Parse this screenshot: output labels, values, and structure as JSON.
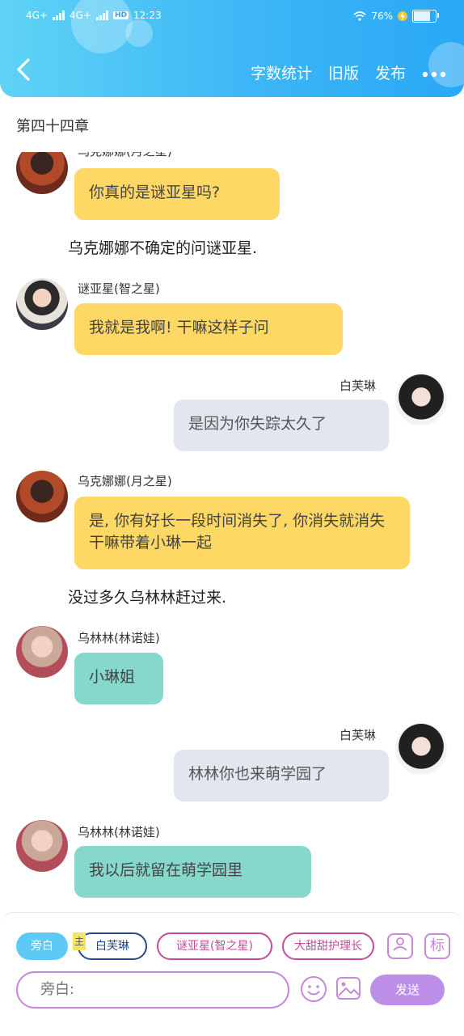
{
  "status_bar": {
    "network1": "4G+",
    "network2": "4G+",
    "hd": "HD",
    "time": "12:23",
    "battery": "76%"
  },
  "header": {
    "back_icon": "chevron-left-icon",
    "actions": [
      "字数统计",
      "旧版",
      "发布"
    ],
    "more_icon": "more-dots-icon"
  },
  "chapter_title": "第四十四章",
  "messages": [
    {
      "type": "left",
      "speaker": "乌克娜娜(月之星)",
      "text": "你真的是谜亚星吗?",
      "color": "yellow"
    },
    {
      "type": "narration",
      "text": "乌克娜娜不确定的问谜亚星."
    },
    {
      "type": "left",
      "speaker": "谜亚星(智之星)",
      "text": "我就是我啊! 干嘛这样子问",
      "color": "yellow"
    },
    {
      "type": "right",
      "speaker": "白芙琳",
      "text": "是因为你失踪太久了",
      "color": "gray"
    },
    {
      "type": "left",
      "speaker": "乌克娜娜(月之星)",
      "text": "是, 你有好长一段时间消失了, 你消失就消失干嘛带着小琳一起",
      "color": "yellow"
    },
    {
      "type": "narration",
      "text": "没过多久乌林林赶过来."
    },
    {
      "type": "left",
      "speaker": "乌林林(林诺娃)",
      "text": "小琳姐",
      "color": "teal"
    },
    {
      "type": "right",
      "speaker": "白芙琳",
      "text": "林林你也来萌学园了",
      "color": "gray"
    },
    {
      "type": "left",
      "speaker": "乌林林(林诺娃)",
      "text": "我以后就留在萌学园里",
      "color": "teal"
    }
  ],
  "composer": {
    "chips": [
      "旁白",
      "白芙琳",
      "谜亚星(智之星)",
      "大甜甜护理长"
    ],
    "main_tag": "主",
    "role_icon": "person-card-icon",
    "tag_icon_label": "标",
    "input_placeholder": "旁白:",
    "emoji_icon": "smile-icon",
    "image_icon": "image-icon",
    "send_label": "发送"
  },
  "colors": {
    "header_start": "#5fd3f5",
    "header_end": "#2aa8f5",
    "yellow_bubble": "#fdd864",
    "gray_bubble": "#e2e6ee",
    "teal_bubble": "#86d8cc",
    "accent_purple": "#bd8fe8"
  }
}
